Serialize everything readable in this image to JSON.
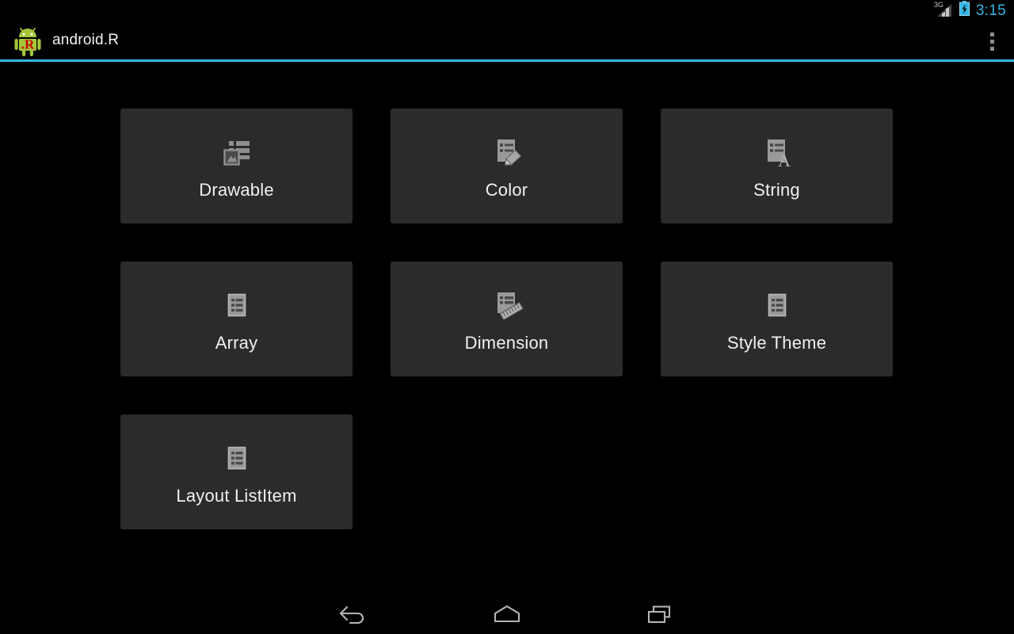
{
  "status_bar": {
    "network_label": "3G",
    "signal_icon": "signal-bars-icon",
    "battery_icon": "battery-charging-icon",
    "time": "3:15",
    "accent_color": "#33b5e5"
  },
  "action_bar": {
    "app_icon": "android-r-logo-icon",
    "title": "android.R",
    "overflow_icon": "overflow-menu-icon",
    "underline_color": "#33b5e5",
    "background_color": "#000000"
  },
  "content": {
    "background_color": "#000000",
    "card_color": "#2b2b2b",
    "cards": [
      {
        "label": "Drawable",
        "icon": "list-with-image-icon"
      },
      {
        "label": "Color",
        "icon": "document-with-pencil-icon"
      },
      {
        "label": "String",
        "icon": "document-with-letter-a-icon"
      },
      {
        "label": "Array",
        "icon": "list-document-icon"
      },
      {
        "label": "Dimension",
        "icon": "document-with-ruler-icon"
      },
      {
        "label": "Style Theme",
        "icon": "list-document-icon"
      },
      {
        "label": "Layout ListItem",
        "icon": "list-document-icon"
      }
    ]
  },
  "nav_bar": {
    "back_label": "Back",
    "home_label": "Home",
    "recents_label": "Recent apps",
    "back_icon": "back-arrow-icon",
    "home_icon": "home-icon",
    "recents_icon": "recent-apps-icon"
  }
}
